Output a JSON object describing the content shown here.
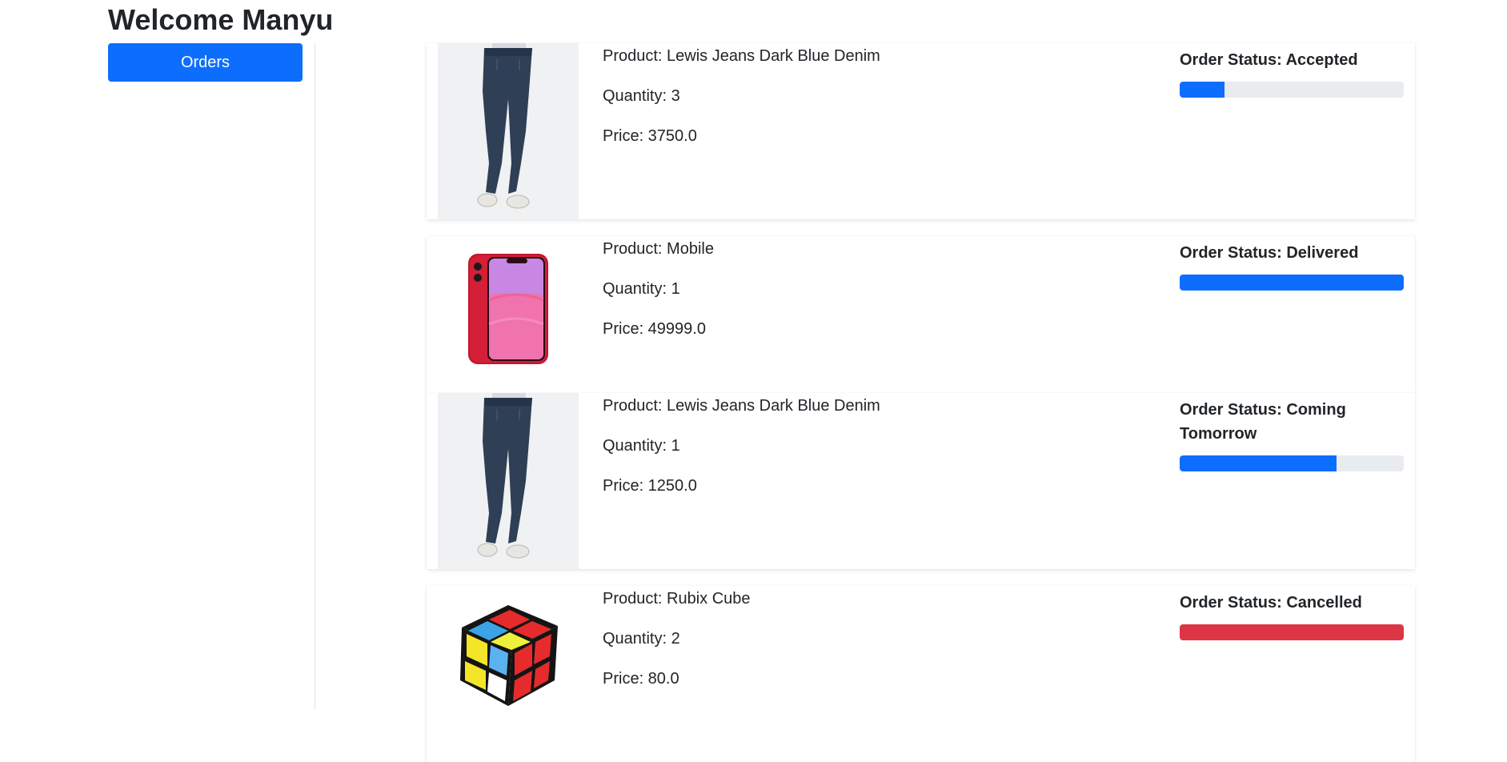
{
  "header": {
    "title": "Welcome Manyu"
  },
  "sidebar": {
    "orders_label": "Orders"
  },
  "colors": {
    "primary": "#0d6efd",
    "danger": "#dc3545",
    "track": "#e9ecef"
  },
  "orders": [
    {
      "product_label": "Product: Lewis Jeans Dark Blue Denim",
      "quantity_label": "Quantity: 3",
      "price_label": "Price: 3750.0",
      "status_label": "Order Status: Accepted",
      "progress": 0.2,
      "bar_color": "#0d6efd",
      "image_icon": "jeans-image"
    },
    {
      "product_label": "Product: Mobile",
      "quantity_label": "Quantity: 1",
      "price_label": "Price: 49999.0",
      "status_label": "Order Status: Delivered",
      "progress": 1.0,
      "bar_color": "#0d6efd",
      "image_icon": "phone-image"
    },
    {
      "product_label": "Product: Lewis Jeans Dark Blue Denim",
      "quantity_label": "Quantity: 1",
      "price_label": "Price: 1250.0",
      "status_label": "Order Status: Coming Tomorrow",
      "progress": 0.7,
      "bar_color": "#0d6efd",
      "image_icon": "jeans-image"
    },
    {
      "product_label": "Product: Rubix Cube",
      "quantity_label": "Quantity: 2",
      "price_label": "Price: 80.0",
      "status_label": "Order Status: Cancelled",
      "progress": 1.0,
      "bar_color": "#dc3545",
      "image_icon": "rubiks-cube-image"
    }
  ]
}
